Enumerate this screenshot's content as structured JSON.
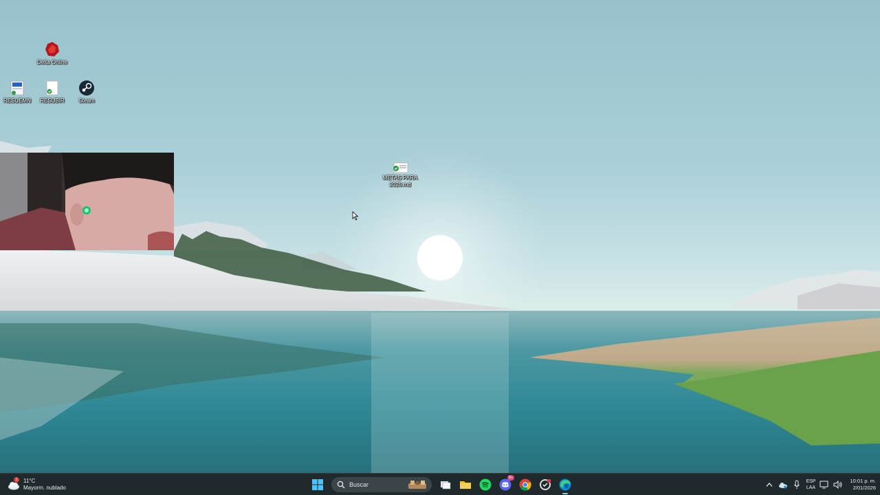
{
  "desktop": {
    "icons": [
      {
        "label": "Delta Online",
        "icon": "delta-online-app-icon"
      },
      {
        "label": "RESUEMN",
        "icon": "document-icon"
      },
      {
        "label": "RESUBIR",
        "icon": "document-icon"
      },
      {
        "label": "Steam",
        "icon": "steam-icon"
      },
      {
        "label": "METAS PARA 2026.md",
        "icon": "markdown-file-icon"
      }
    ],
    "metas_label_line1": "METAS PARA",
    "metas_label_line2": "2026.md"
  },
  "taskbar": {
    "weather": {
      "temperature": "11°C",
      "condition": "Mayorm. nublado",
      "alert_count": "1"
    },
    "search_placeholder": "Buscar",
    "pinned": [
      {
        "name": "start-button",
        "icon": "windows-logo-icon"
      },
      {
        "name": "task-view",
        "icon": "task-view-icon"
      },
      {
        "name": "file-explorer",
        "icon": "folder-icon"
      },
      {
        "name": "spotify",
        "icon": "spotify-icon"
      },
      {
        "name": "discord",
        "icon": "discord-icon",
        "badge": "9+"
      },
      {
        "name": "chrome",
        "icon": "chrome-icon"
      },
      {
        "name": "app-with-notification",
        "icon": "app-icon"
      },
      {
        "name": "edge",
        "icon": "edge-icon"
      }
    ],
    "tray": {
      "language_line1": "ESP",
      "language_line2": "LAA",
      "time": "10:01 p. m.",
      "date": "2/01/2026"
    }
  },
  "colors": {
    "taskbar": "#1f2a2c",
    "accent": "#8ccfe0"
  }
}
